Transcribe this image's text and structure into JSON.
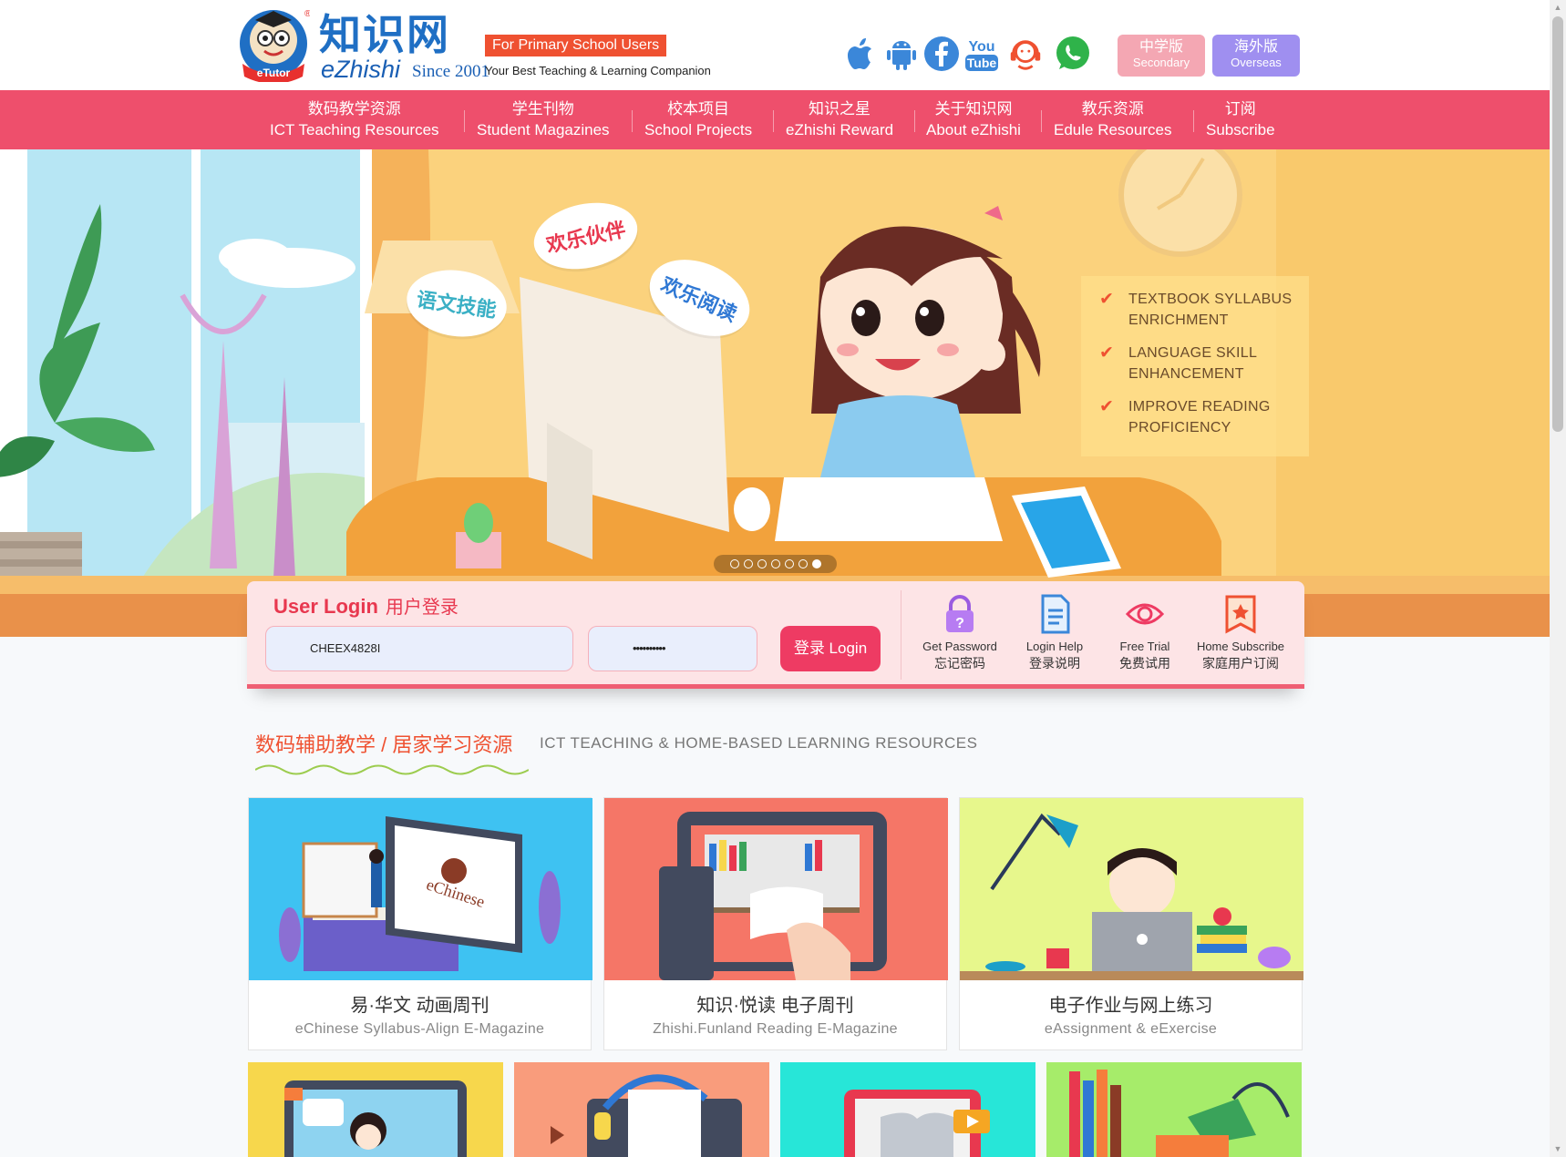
{
  "header": {
    "logo_cn": "知识网",
    "logo_en": "eZhishi",
    "logo_since": "Since 2001",
    "logo_badge_text": "eTutor",
    "tagline_badge": "For Primary School Users",
    "tagline_sub": "Your Best Teaching & Learning Companion",
    "social_icons": [
      "apple-icon",
      "android-icon",
      "facebook-icon",
      "youtube-icon",
      "headset-icon",
      "whatsapp-icon"
    ],
    "youtube_text_1": "You",
    "youtube_text_2": "Tube",
    "versions": [
      {
        "cn": "中学版",
        "en": "Secondary",
        "color": "#f4a7b3"
      },
      {
        "cn": "海外版",
        "en": "Overseas",
        "color": "#9f8ff0"
      }
    ]
  },
  "nav": {
    "items": [
      {
        "cn": "数码教学资源",
        "en": "ICT Teaching Resources"
      },
      {
        "cn": "学生刊物",
        "en": "Student Magazines"
      },
      {
        "cn": "校本项目",
        "en": "School Projects"
      },
      {
        "cn": "知识之星",
        "en": "eZhishi Reward"
      },
      {
        "cn": "关于知识网",
        "en": "About eZhishi"
      },
      {
        "cn": "教乐资源",
        "en": "Edule Resources"
      },
      {
        "cn": "订阅",
        "en": "Subscribe"
      }
    ],
    "color": "#ee4f6c"
  },
  "hero": {
    "bubbles": [
      "语文技能",
      "欢乐伙伴",
      "欢乐阅读"
    ],
    "benefits": [
      "TEXTBOOK SYLLABUS ENRICHMENT",
      "LANGUAGE SKILL ENHANCEMENT",
      "IMPROVE READING PROFICIENCY"
    ],
    "slide_count": 7,
    "active_slide": 7
  },
  "login": {
    "title_en": "User Login",
    "title_cn": "用户登录",
    "username_value": "CHEEX4828I",
    "password_value": "••••••••••",
    "button_label": "登录 Login",
    "tools": [
      {
        "en": "Get Password",
        "cn": "忘记密码",
        "icon": "lock-question-icon"
      },
      {
        "en": "Login Help",
        "cn": "登录说明",
        "icon": "document-icon"
      },
      {
        "en": "Free Trial",
        "cn": "免费试用",
        "icon": "eye-icon"
      },
      {
        "en": "Home Subscribe",
        "cn": "家庭用户订阅",
        "icon": "star-bookmark-icon"
      }
    ]
  },
  "resources": {
    "title_cn": "数码辅助教学 / 居家学习资源",
    "title_en": "ICT TEACHING & HOME-BASED LEARNING RESOURCES",
    "cards": [
      {
        "cn": "易·华文 动画周刊",
        "en": "eChinese Syllabus-Align E-Magazine",
        "color": "#3ec2f2"
      },
      {
        "cn": "知识·悦读 电子周刊",
        "en": "Zhishi.Funland Reading E-Magazine",
        "color": "#f57667"
      },
      {
        "cn": "电子作业与网上练习",
        "en": "eAssignment & eExercise",
        "color": "#e7f78c"
      }
    ],
    "card_echinese_logo": "eChinese",
    "more_cards": [
      {
        "color": "#f7d74c"
      },
      {
        "color": "#f99c7c"
      },
      {
        "color": "#27e6d8"
      },
      {
        "color": "#a6ec6a"
      }
    ]
  }
}
